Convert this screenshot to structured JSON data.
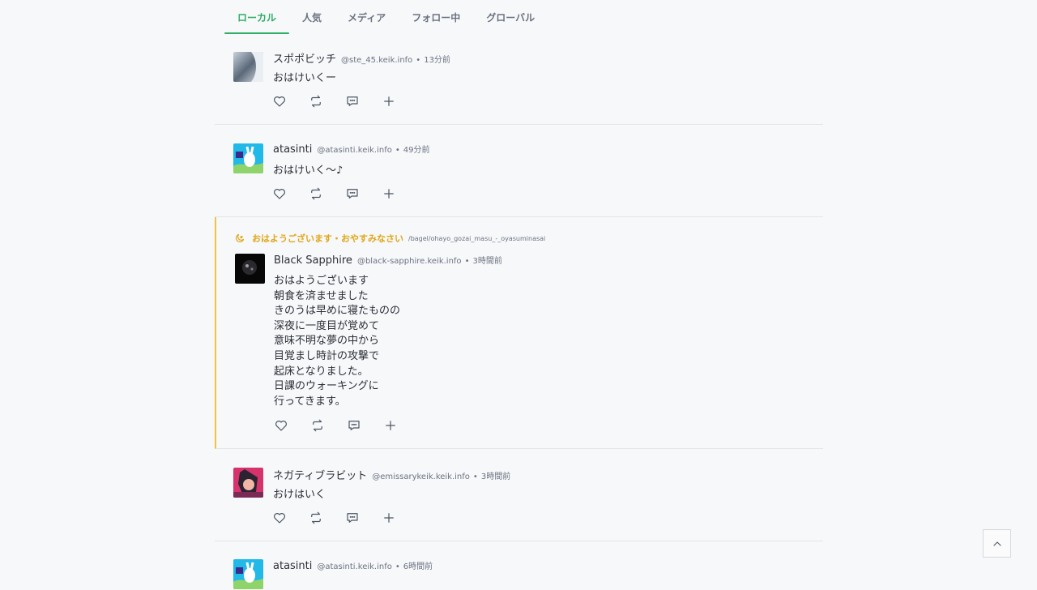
{
  "tabs": [
    {
      "label": "ローカル",
      "active": true
    },
    {
      "label": "人気"
    },
    {
      "label": "メディア"
    },
    {
      "label": "フォロー中"
    },
    {
      "label": "グローバル"
    }
  ],
  "notes": [
    {
      "name": "スポポビッチ",
      "acct": "@ste_45.keik.info",
      "time": "13分前",
      "text": "おはけいくー"
    },
    {
      "name": "atasinti",
      "acct": "@atasinti.keik.info",
      "time": "49分前",
      "text": "おはけいく〜♪"
    },
    {
      "channel": {
        "icon": "moon-icon",
        "name": "おはようございます・おやすみなさい",
        "path": "/bagel/ohayo_gozai_masu_-_oyasuminasai"
      },
      "name": "Black Sapphire",
      "acct": "@black-sapphire.keik.info",
      "time": "3時間前",
      "text": "おはようございます\n朝食を済ませました\nきのうは早めに寝たものの\n深夜に一度目が覚めて\n意味不明な夢の中から\n目覚まし時計の攻撃で\n起床となりました。\n日課のウォーキングに\n行ってきます。"
    },
    {
      "name": "ネガティブラビット",
      "acct": "@emissarykeik.keik.info",
      "time": "3時間前",
      "text": "おけはいく"
    },
    {
      "name": "atasinti",
      "acct": "@atasinti.keik.info",
      "time": "6時間前",
      "text": ""
    }
  ],
  "separator": "•",
  "colors": {
    "accent": "#2fae66",
    "channel": "#e0a718",
    "text": "#2b2f36",
    "muted": "#6b7280"
  },
  "icons": [
    "heart-icon",
    "renote-icon",
    "reply-icon",
    "plus-icon",
    "chevron-up-icon"
  ]
}
